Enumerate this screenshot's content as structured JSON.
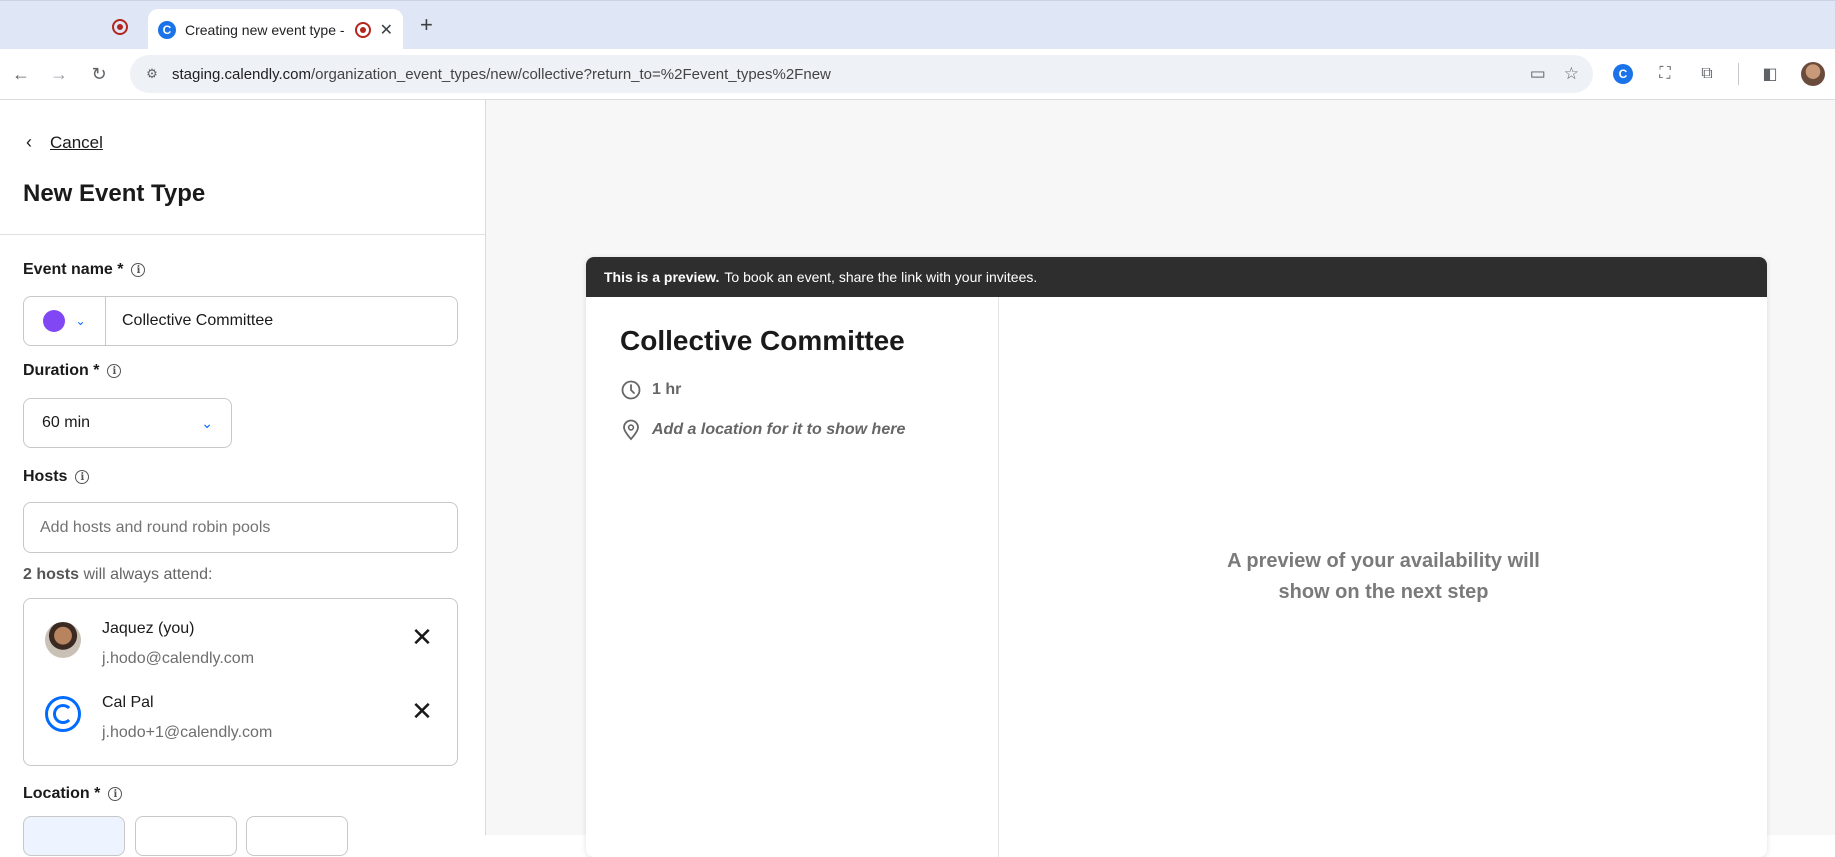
{
  "browser": {
    "active_tab_title": "Creating new event type -",
    "url_domain": "staging.calendly.com",
    "url_path": "/organization_event_types/new/collective?return_to=%2Fevent_types%2Fnew",
    "new_tab_glyph": "+",
    "close_glyph": "✕"
  },
  "left_panel": {
    "cancel_label": "Cancel",
    "page_title": "New Event Type",
    "event_name": {
      "label": "Event name *",
      "value": "Collective Committee",
      "color": "#8247f5"
    },
    "duration": {
      "label": "Duration *",
      "value": "60 min"
    },
    "hosts": {
      "label": "Hosts",
      "placeholder": "Add hosts and round robin pools",
      "note_count": "2 hosts",
      "note_text": " will always attend:",
      "list": [
        {
          "name": "Jaquez (you)",
          "email": "j.hodo@calendly.com"
        },
        {
          "name": "Cal Pal",
          "email": "j.hodo+1@calendly.com"
        }
      ]
    },
    "location": {
      "label": "Location *"
    }
  },
  "preview": {
    "banner_bold": "This is a preview.",
    "banner_text": "To book an event, share the link with your invitees.",
    "event_title": "Collective Committee",
    "duration_text": "1 hr",
    "location_text": "Add a location for it to show here",
    "availability_text": "A preview of your availability will show on the next step"
  },
  "colors": {
    "accent": "#0069ff",
    "event_color": "#8247f5",
    "banner_bg": "#2e2e2e"
  }
}
